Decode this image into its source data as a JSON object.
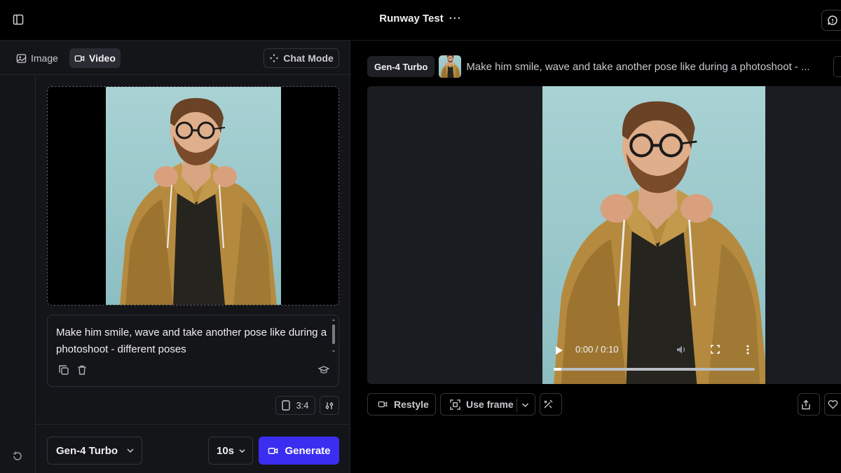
{
  "header": {
    "title": "Runway Test",
    "more": "···"
  },
  "left_panel": {
    "mode_tabs": [
      {
        "label": "Image",
        "icon": "image-icon",
        "active": false
      },
      {
        "label": "Video",
        "icon": "video-icon",
        "active": true
      }
    ],
    "chat_mode_label": "Chat Mode",
    "prompt": "Make him smile, wave and take another pose like during a photoshoot - different poses",
    "aspect_ratio": "3:4",
    "model": "Gen-4 Turbo",
    "duration": "10s",
    "generate_label": "Generate"
  },
  "generation": {
    "model": "Gen-4 Turbo",
    "prompt": "Make him smile, wave and take another pose like during a photoshoot - ...",
    "player": {
      "time": "0:00 / 0:10",
      "progress": 0.04
    },
    "actions": {
      "restyle": "Restyle",
      "use_frame": "Use frame"
    }
  },
  "colors": {
    "accent": "#3b2ef0",
    "panel": "#141519",
    "background": "#000000",
    "photo_backdrop": "#9fc9cc"
  }
}
